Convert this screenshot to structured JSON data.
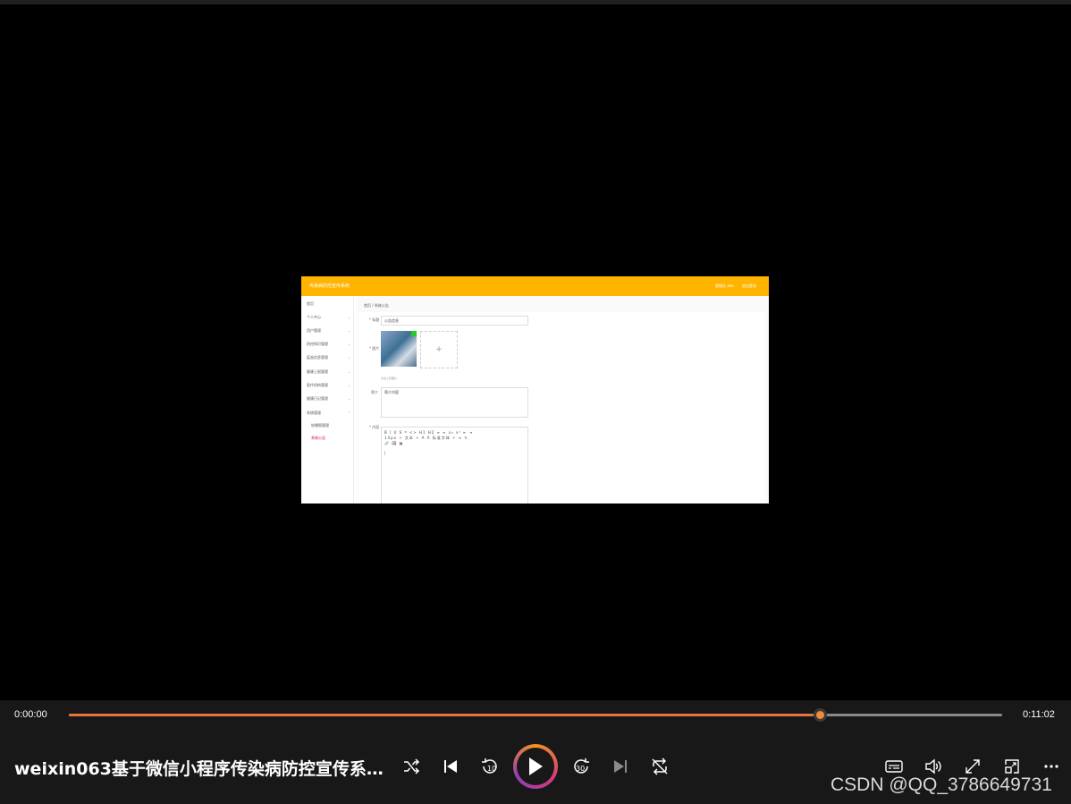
{
  "player": {
    "current_time": "0:00:00",
    "total_time": "0:11:02",
    "progress_fraction": 0.805,
    "video_title": "weixin063基于微信小程序传染病防控宣传系…",
    "watermark": "CSDN @QQ_3786649731",
    "accent_color": "#e8743b",
    "controls": {
      "shuffle": "shuffle-icon",
      "previous": "skip-previous-icon",
      "rewind": "rewind-10-icon",
      "rewind_label": "10",
      "play": "play-icon",
      "forward": "forward-30-icon",
      "forward_label": "30",
      "next": "skip-next-icon",
      "repeat": "repeat-off-icon",
      "subtitles": "subtitles-icon",
      "volume": "volume-icon",
      "fullscreen": "fullscreen-icon",
      "miniplayer": "miniplayer-icon",
      "more": "more-icon"
    }
  },
  "frame": {
    "app_title": "传染病防控宣传系统",
    "header_user": "管理员 abo",
    "header_logout": "退出登录",
    "header_color": "#ffb400",
    "menu": [
      {
        "label": "首页",
        "sub": false
      },
      {
        "label": "个人中心",
        "sub": false
      },
      {
        "label": "用户管理",
        "sub": false
      },
      {
        "label": "防控知识管理",
        "sub": false
      },
      {
        "label": "疫苗信息管理",
        "sub": false
      },
      {
        "label": "健康上报管理",
        "sub": false
      },
      {
        "label": "医疗机构管理",
        "sub": false
      },
      {
        "label": "健康日记管理",
        "sub": false
      },
      {
        "label": "系统管理",
        "sub": false
      },
      {
        "label": "轮播图管理",
        "sub": true
      },
      {
        "label": "系统公告",
        "sub": true,
        "active": true
      }
    ],
    "breadcrumb": "首页 / 系统公告",
    "form": {
      "title_label": "* 标题",
      "title_value": "公告信息",
      "image_label": "* 图片",
      "upload_plus": "+",
      "upload_tip": "点击上传图片",
      "summary_label": "简介",
      "summary_value": "简介内容",
      "content_label": "* 内容",
      "toolbar_row1": "B I U S  ❝ <>  H1 H2  ≡ ≡  x₂ x²  ⇤ ⇥",
      "toolbar_row2": "14px  ÷  文本  ÷  A  A  标准字体  ÷  ≡  ✎",
      "toolbar_row3": "🔗 🖼 ▦",
      "cursor": "|"
    }
  }
}
